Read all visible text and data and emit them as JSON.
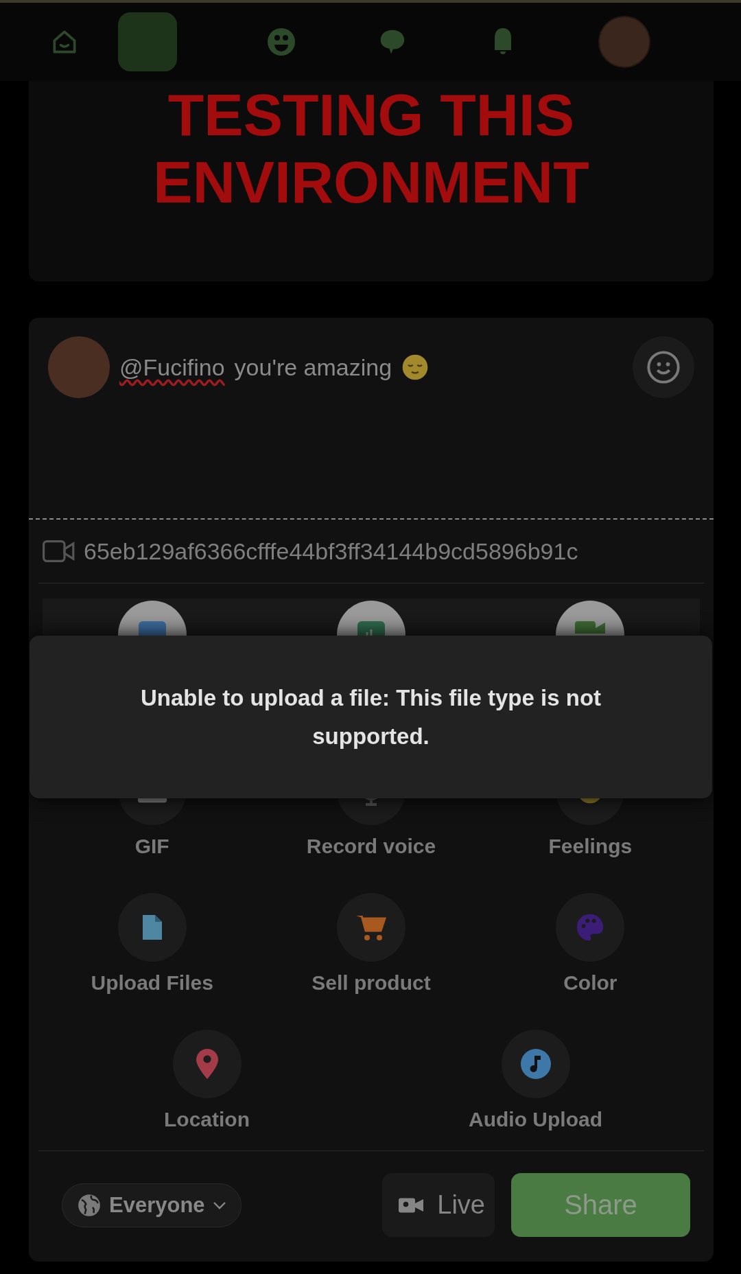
{
  "nav": {
    "items": [
      {
        "kind": "home",
        "selected": false
      },
      {
        "kind": "square",
        "selected": true
      },
      {
        "kind": "groups",
        "selected": false
      },
      {
        "kind": "chat",
        "selected": false
      },
      {
        "kind": "bell",
        "selected": false
      },
      {
        "kind": "avatar",
        "selected": false
      }
    ]
  },
  "banner": {
    "title": "TESTING THIS ENVIRONMENT"
  },
  "composer": {
    "mention": "@Fucifino",
    "mention_misspelled": true,
    "text": "you're amazing",
    "video_file": "65eb129af6366cfffe44bf3ff34144b9cd5896b91c"
  },
  "action_rows": [
    {
      "items": [
        {
          "kind": "image"
        },
        {
          "kind": "poll"
        },
        {
          "kind": "video"
        }
      ]
    },
    {
      "items": [
        {
          "kind": "gif",
          "label": "GIF"
        },
        {
          "kind": "voice",
          "label": "Record voice"
        },
        {
          "kind": "feelings",
          "label": "Feelings"
        }
      ]
    },
    {
      "items": [
        {
          "kind": "file",
          "label": "Upload Files"
        },
        {
          "kind": "cart",
          "label": "Sell product"
        },
        {
          "kind": "palette",
          "label": "Color"
        }
      ]
    },
    {
      "items": [
        {
          "kind": "pin",
          "label": "Location"
        },
        {
          "kind": "music",
          "label": "Audio Upload"
        }
      ]
    }
  ],
  "toast": {
    "message": "Unable to upload a file: This file type is not supported."
  },
  "footer": {
    "audience": "Everyone",
    "live": "Live",
    "share": "Share"
  }
}
